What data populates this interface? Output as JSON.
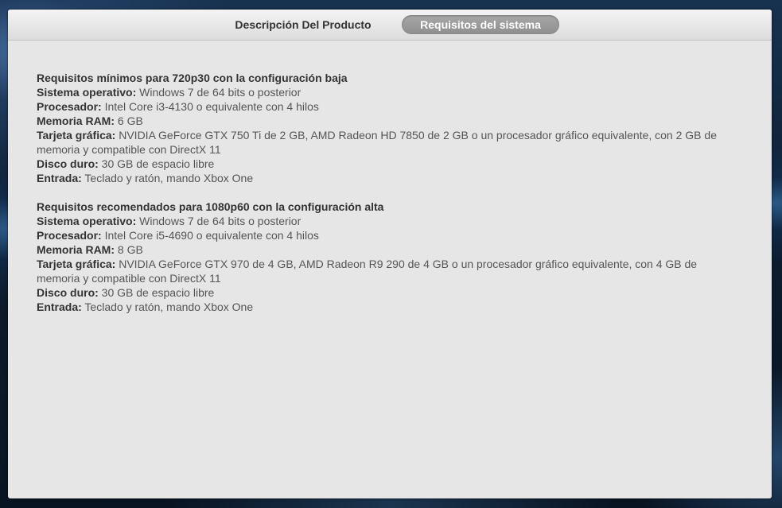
{
  "tabs": {
    "description": "Descripción Del Producto",
    "requirements": "Requisitos del sistema"
  },
  "sections": [
    {
      "heading": "Requisitos mínimos para 720p30 con la configuración baja",
      "rows": [
        {
          "label": "Sistema operativo:",
          "value": " Windows 7 de 64 bits o posterior"
        },
        {
          "label": "Procesador:",
          "value": " Intel Core i3-4130 o equivalente con 4 hilos"
        },
        {
          "label": "Memoria RAM:",
          "value": " 6 GB"
        },
        {
          "label": "Tarjeta gráfica:",
          "value": " NVIDIA GeForce GTX 750 Ti de 2 GB, AMD Radeon HD 7850 de 2 GB o un procesador gráfico equivalente, con 2 GB de memoria y compatible con DirectX 11"
        },
        {
          "label": "Disco duro:",
          "value": " 30 GB de espacio libre"
        },
        {
          "label": "Entrada:",
          "value": " Teclado y ratón, mando Xbox One"
        }
      ]
    },
    {
      "heading": "Requisitos recomendados para 1080p60 con la configuración alta",
      "rows": [
        {
          "label": "Sistema operativo:",
          "value": " Windows 7 de 64 bits o posterior"
        },
        {
          "label": "Procesador:",
          "value": " Intel Core i5-4690 o equivalente con 4 hilos"
        },
        {
          "label": "Memoria RAM:",
          "value": " 8 GB"
        },
        {
          "label": "Tarjeta gráfica:",
          "value": " NVIDIA GeForce GTX 970 de 4 GB, AMD Radeon R9 290 de 4 GB o un procesador gráfico equivalente, con 4 GB de memoria y compatible con DirectX 11"
        },
        {
          "label": "Disco duro:",
          "value": " 30 GB de espacio libre"
        },
        {
          "label": "Entrada:",
          "value": " Teclado y ratón, mando Xbox One"
        }
      ]
    }
  ],
  "colors": {
    "panel_bg": "#e6e6e6",
    "active_tab_bg": "#9a9a9a",
    "active_tab_text": "#ffffff",
    "text": "#444444"
  }
}
